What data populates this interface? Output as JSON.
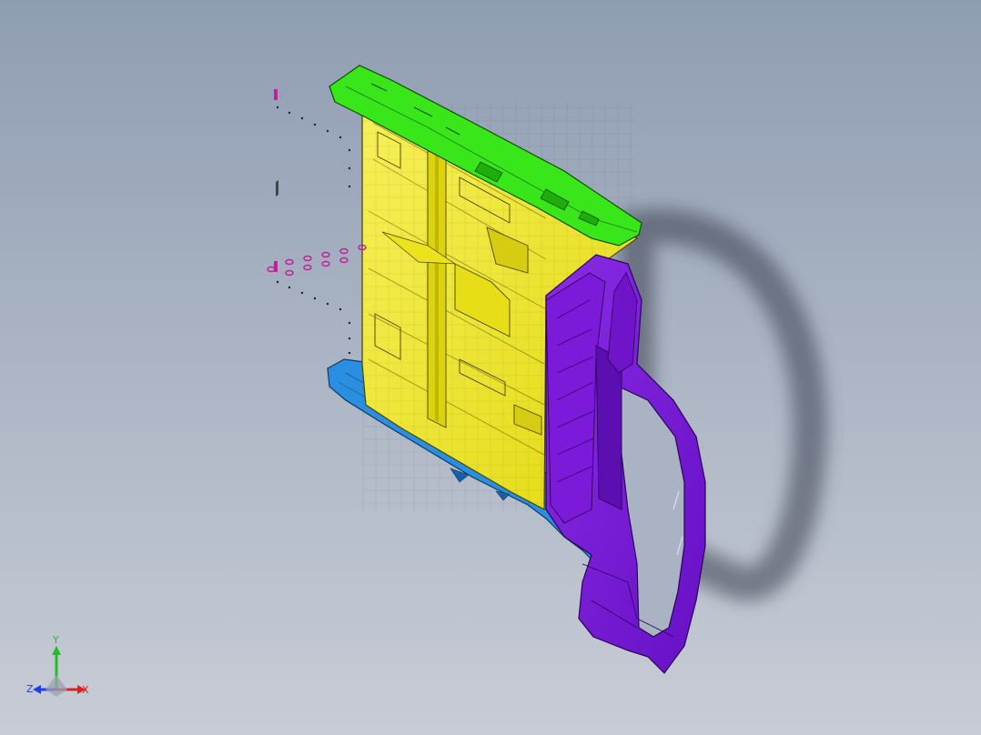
{
  "viewport": {
    "background_top": "#8f9db2",
    "background_bottom": "#c8ccd6"
  },
  "model": {
    "parts": [
      {
        "name": "top-rail",
        "color": "#39e61a"
      },
      {
        "name": "center-panel",
        "color": "#f0ea1a"
      },
      {
        "name": "bottom-rail",
        "color": "#2a8fe0"
      },
      {
        "name": "side-frame",
        "color": "#7a17d6"
      },
      {
        "name": "fasteners",
        "color": "#c0209a"
      }
    ],
    "shadow_color": "#3a4150"
  },
  "triad": {
    "x_label": "X",
    "y_label": "Y",
    "z_label": "Z",
    "x_color": "#e02020",
    "y_color": "#20c020",
    "z_color": "#2040e0"
  }
}
